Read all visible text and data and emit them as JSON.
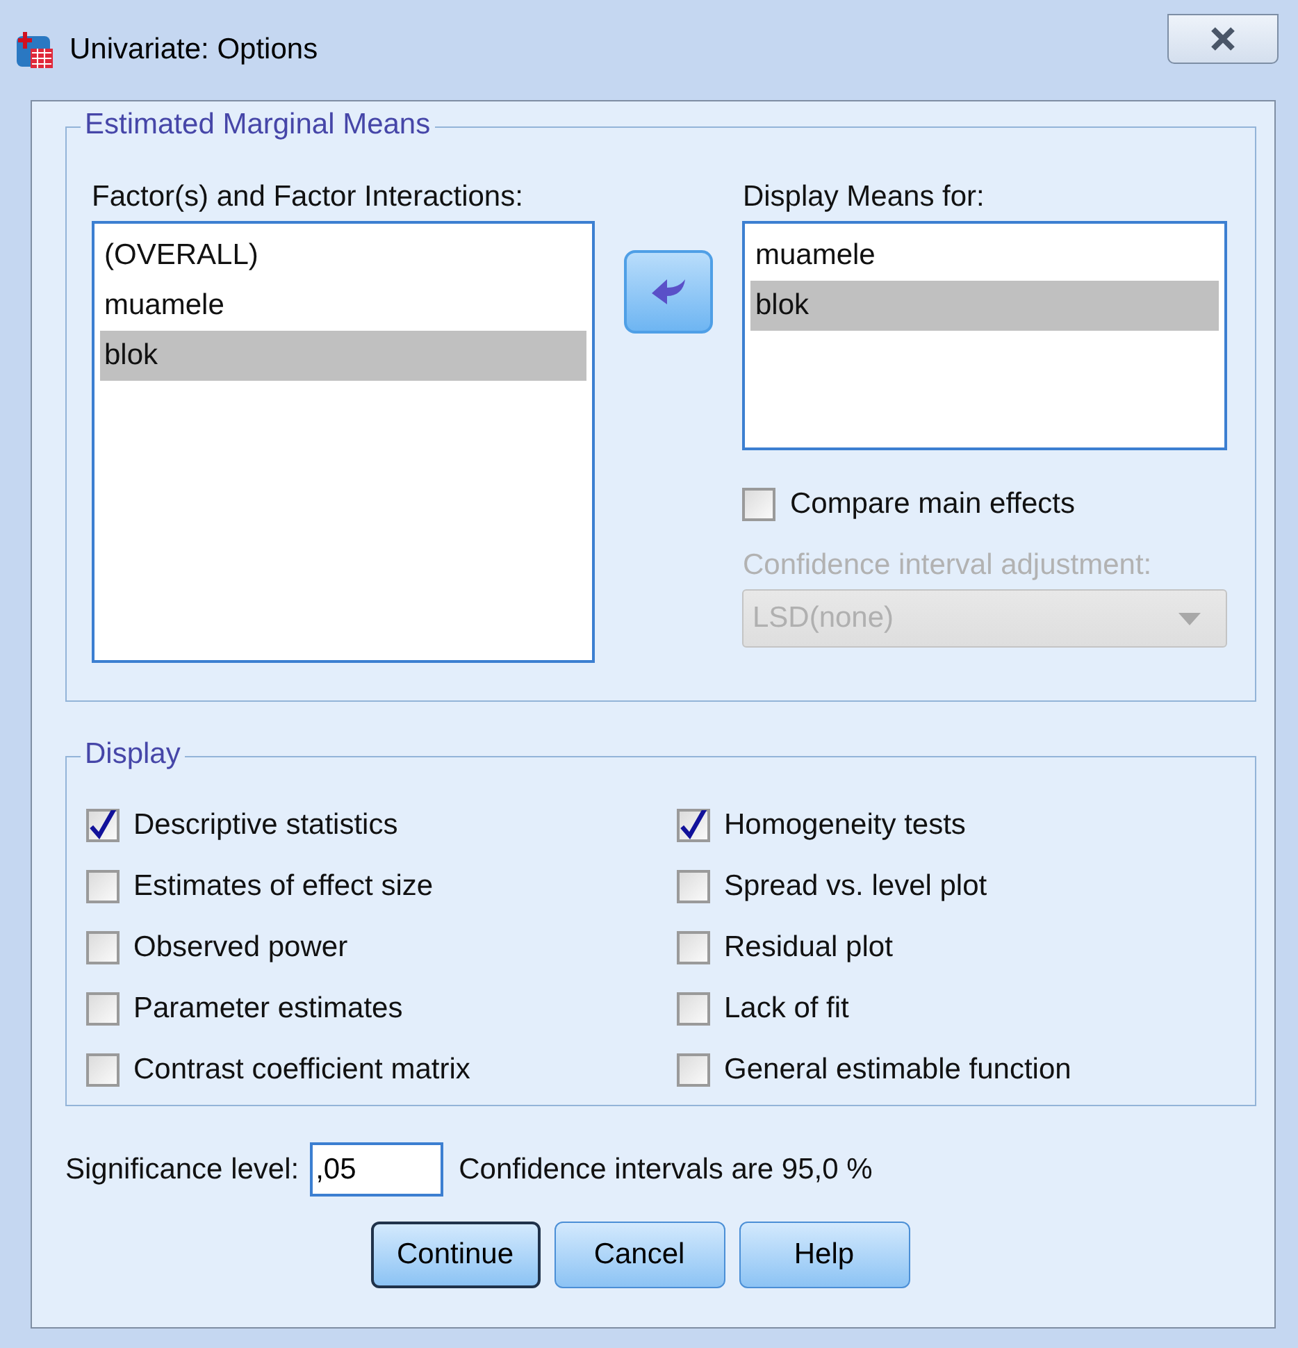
{
  "window": {
    "title": "Univariate: Options"
  },
  "estimated_marginal_means": {
    "title": "Estimated Marginal Means",
    "factors": {
      "label": "Factor(s) and Factor Interactions:",
      "items": [
        {
          "text": "(OVERALL)",
          "selected": false
        },
        {
          "text": "muamele",
          "selected": false
        },
        {
          "text": "blok",
          "selected": true
        }
      ]
    },
    "display_means": {
      "label": "Display Means for:",
      "items": [
        {
          "text": "muamele",
          "selected": false
        },
        {
          "text": "blok",
          "selected": true
        }
      ]
    },
    "compare_main_effects": {
      "label": "Compare main effects",
      "checked": false
    },
    "ci_adjustment": {
      "label": "Confidence interval adjustment:",
      "value": "LSD(none)",
      "disabled": true
    }
  },
  "display": {
    "title": "Display",
    "columns": [
      [
        {
          "label": "Descriptive statistics",
          "checked": true
        },
        {
          "label": "Estimates of effect size",
          "checked": false
        },
        {
          "label": "Observed power",
          "checked": false
        },
        {
          "label": "Parameter estimates",
          "checked": false
        },
        {
          "label": "Contrast coefficient matrix",
          "checked": false
        }
      ],
      [
        {
          "label": "Homogeneity tests",
          "checked": true
        },
        {
          "label": "Spread vs. level plot",
          "checked": false
        },
        {
          "label": "Residual plot",
          "checked": false
        },
        {
          "label": "Lack of fit",
          "checked": false
        },
        {
          "label": "General estimable function",
          "checked": false
        }
      ]
    ]
  },
  "significance": {
    "label": "Significance level:",
    "value": ",05",
    "note": "Confidence intervals are 95,0 %"
  },
  "buttons": [
    {
      "label": "Continue",
      "default": true
    },
    {
      "label": "Cancel",
      "default": false
    },
    {
      "label": "Help",
      "default": false
    }
  ]
}
